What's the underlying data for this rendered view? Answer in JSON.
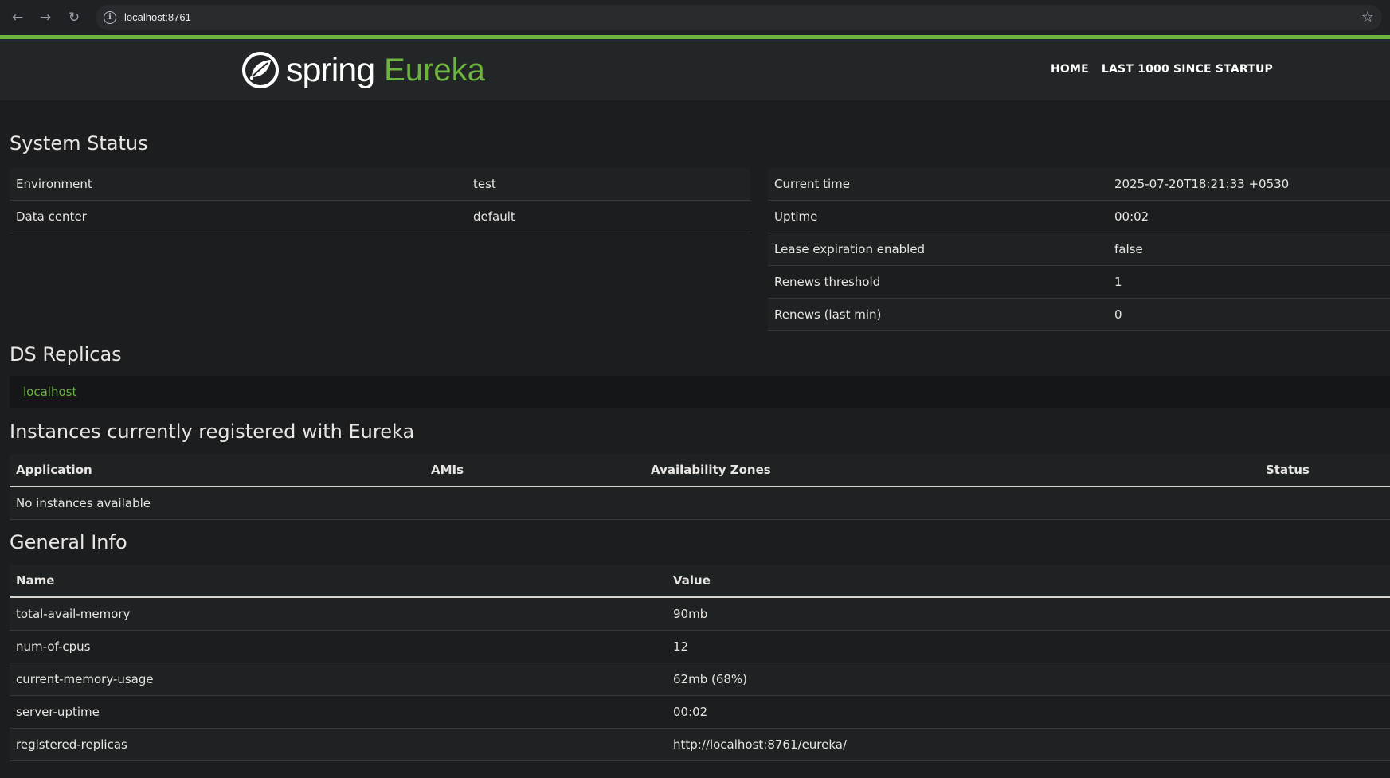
{
  "browser": {
    "url": "localhost:8761",
    "back_icon": "arrow-left-icon",
    "forward_icon": "arrow-right-icon",
    "reload_icon": "reload-icon",
    "info_icon": "info-icon",
    "bookmark_icon": "star-icon"
  },
  "header": {
    "brand_spring": "spring",
    "brand_eureka": "Eureka",
    "nav": [
      "HOME",
      "LAST 1000 SINCE STARTUP"
    ]
  },
  "colors": {
    "accent": "#6db33f",
    "background": "#1b1d1e",
    "header_bg": "#232627"
  },
  "system_status": {
    "title": "System Status",
    "left": [
      {
        "label": "Environment",
        "value": "test"
      },
      {
        "label": "Data center",
        "value": "default"
      }
    ],
    "right": [
      {
        "label": "Current time",
        "value": "2025-07-20T18:21:33 +0530"
      },
      {
        "label": "Uptime",
        "value": "00:02"
      },
      {
        "label": "Lease expiration enabled",
        "value": "false"
      },
      {
        "label": "Renews threshold",
        "value": "1"
      },
      {
        "label": "Renews (last min)",
        "value": "0"
      }
    ]
  },
  "ds_replicas": {
    "title": "DS Replicas",
    "items": [
      "localhost"
    ]
  },
  "instances": {
    "title": "Instances currently registered with Eureka",
    "columns": [
      "Application",
      "AMIs",
      "Availability Zones",
      "Status"
    ],
    "empty_text": "No instances available"
  },
  "general_info": {
    "title": "General Info",
    "columns": [
      "Name",
      "Value"
    ],
    "rows": [
      {
        "name": "total-avail-memory",
        "value": "90mb"
      },
      {
        "name": "num-of-cpus",
        "value": "12"
      },
      {
        "name": "current-memory-usage",
        "value": "62mb (68%)"
      },
      {
        "name": "server-uptime",
        "value": "00:02"
      },
      {
        "name": "registered-replicas",
        "value": "http://localhost:8761/eureka/"
      }
    ]
  }
}
